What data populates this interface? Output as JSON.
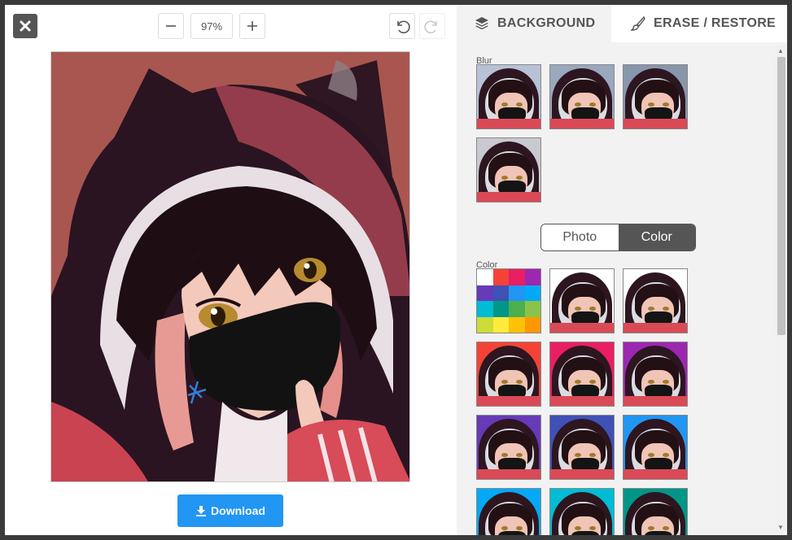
{
  "toolbar": {
    "zoom_value": "97%"
  },
  "download": {
    "label": "Download"
  },
  "tabs": {
    "background": "BACKGROUND",
    "erase_restore": "ERASE / RESTORE"
  },
  "sections": {
    "blur_label": "Blur",
    "color_label": "Color"
  },
  "toggle": {
    "photo": "Photo",
    "color": "Color",
    "selected": "Color"
  },
  "blur_thumbnails": [
    {
      "bg": "#b7c2d6"
    },
    {
      "bg": "#9aa8be"
    },
    {
      "bg": "#8896ab"
    },
    {
      "bg": "#c9c9cf"
    }
  ],
  "color_thumbnails": [
    {
      "bg": "#ffffff"
    },
    {
      "bg": "#ffffff"
    },
    {
      "bg": "#f44336"
    },
    {
      "bg": "#e91e63"
    },
    {
      "bg": "#9c27b0"
    },
    {
      "bg": "#673ab7"
    },
    {
      "bg": "#3f51b5"
    },
    {
      "bg": "#2196f3"
    },
    {
      "bg": "#03a9f4"
    },
    {
      "bg": "#00bcd4"
    },
    {
      "bg": "#009688"
    }
  ],
  "palette_colors": [
    "#ffffff",
    "#f44336",
    "#e91e63",
    "#9c27b0",
    "#673ab7",
    "#3f51b5",
    "#2196f3",
    "#03a9f4",
    "#00bcd4",
    "#009688",
    "#4caf50",
    "#8bc34a",
    "#cddc39",
    "#ffeb3b",
    "#ffc107",
    "#ff9800"
  ],
  "colors": {
    "accent": "#2196f3",
    "dark": "#555555",
    "panel_bg": "#f2f2f2"
  }
}
